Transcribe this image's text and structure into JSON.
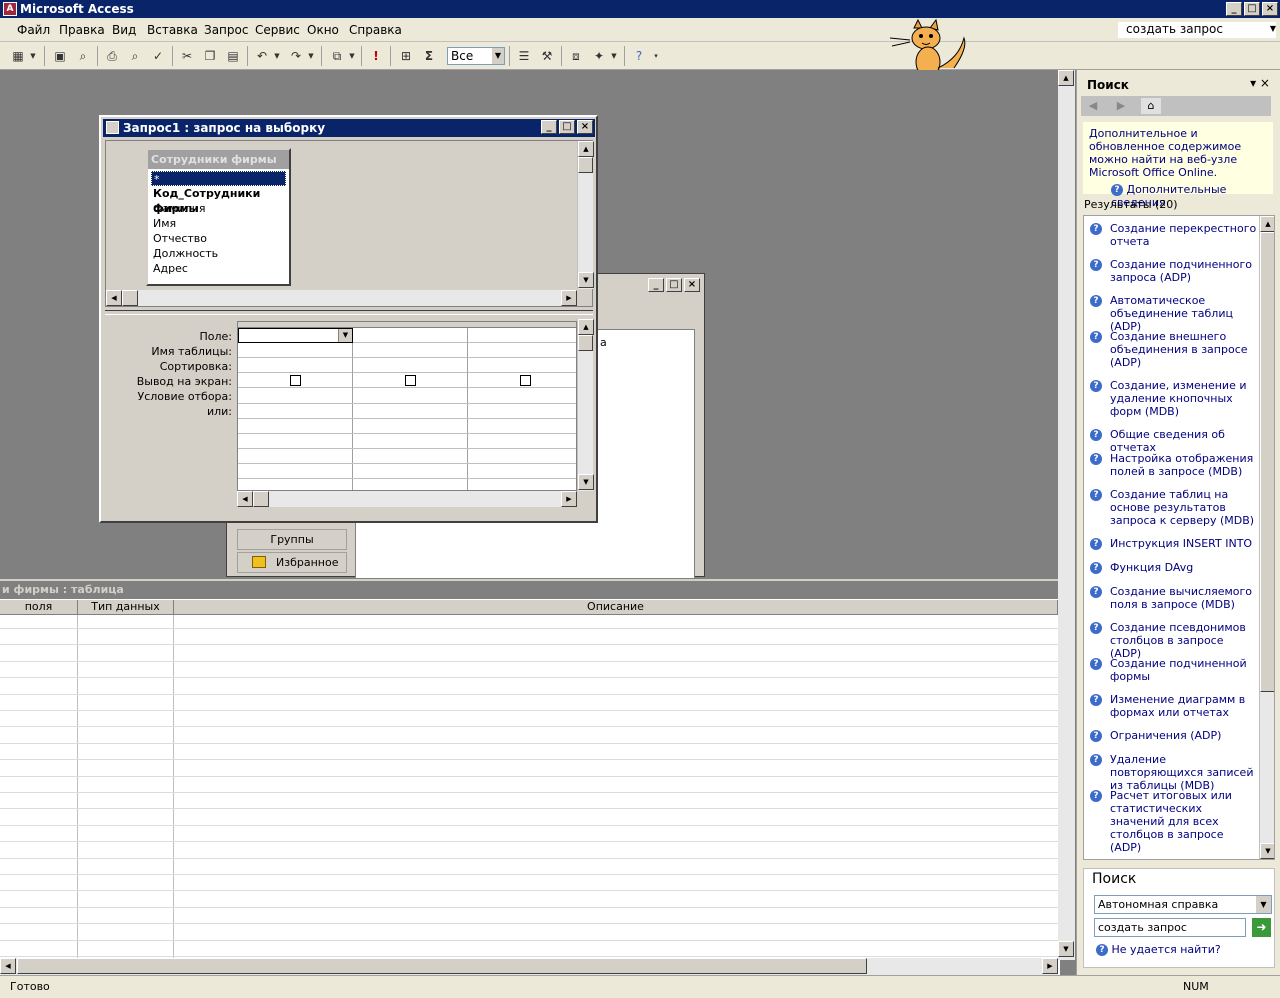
{
  "app": {
    "title": "Microsoft Access",
    "icon_glyph": "A"
  },
  "menu": [
    "Файл",
    "Правка",
    "Вид",
    "Вставка",
    "Запрос",
    "Сервис",
    "Окно",
    "Справка"
  ],
  "help_box": {
    "value": "создать запрос"
  },
  "toolbar": {
    "filter_value": "Все",
    "sigma": "Σ",
    "bang": "!"
  },
  "query_window": {
    "title": "Запрос1 : запрос на выборку",
    "table": {
      "name": "Сотрудники фирмы",
      "fields": [
        "*",
        "Код_Сотрудники фирмы",
        "Фамилия",
        "Имя",
        "Отчество",
        "Должность",
        "Адрес"
      ]
    },
    "row_labels": [
      "Поле:",
      "Имя таблицы:",
      "Сортировка:",
      "Вывод на экран:",
      "Условие отбора:",
      "или:"
    ]
  },
  "back_window": {
    "groups_label": "Группы",
    "favorites_label": "Избранное",
    "partial_text": "а"
  },
  "bottom_table": {
    "title": "и фирмы : таблица",
    "columns": [
      "поля",
      "Тип данных",
      "Описание"
    ]
  },
  "task_pane": {
    "title": "Поиск",
    "online_text": "Дополнительное и обновленное содержимое можно найти на веб-узле Microsoft Office Online.",
    "more_info": "Дополнительные сведения",
    "results_label": "Результаты (20)",
    "results": [
      "Создание перекрестного отчета",
      "Создание подчиненного запроса (ADP)",
      "Автоматическое объединение таблиц (ADP)",
      "Создание внешнего объединения в запросе (ADP)",
      "Создание, изменение и удаление кнопочных форм (MDB)",
      "Общие сведения об отчетах",
      "Настройка отображения полей в запросе (MDB)",
      "Создание таблиц на основе результатов запроса к серверу (MDB)",
      "Инструкция INSERT INTO",
      "Функция DAvg",
      "Создание вычисляемого поля в запросе (MDB)",
      "Создание псевдонимов столбцов в запросе (ADP)",
      "Создание подчиненной формы",
      "Изменение диаграмм в формах или отчетах",
      "Ограничения (ADP)",
      "Удаление повторяющихся записей из таблицы (MDB)",
      "Расчет итоговых или статистических значений для всех столбцов в запросе (ADP)"
    ],
    "search_section_title": "Поиск",
    "search_scope": "Автономная справка",
    "search_value": "создать запрос",
    "cant_find": "Не удается найти?"
  },
  "status": {
    "left": "Готово",
    "num": "NUM"
  }
}
